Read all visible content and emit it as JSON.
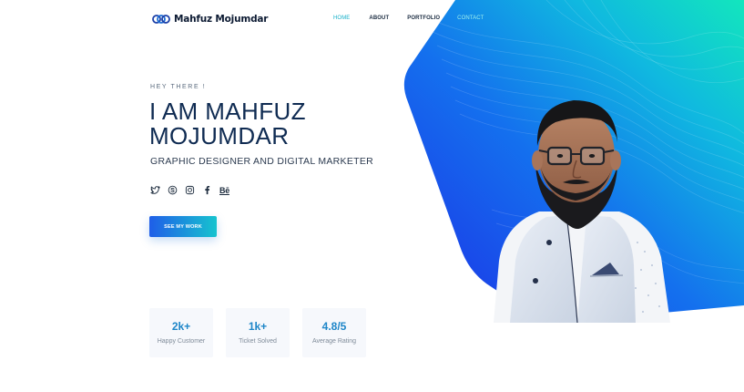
{
  "brand": {
    "name": "Mahfuz Mojumdar"
  },
  "nav": [
    {
      "label": "HOME",
      "state": "active"
    },
    {
      "label": "ABOUT",
      "state": ""
    },
    {
      "label": "PORTFOLIO",
      "state": ""
    },
    {
      "label": "CONTACT",
      "state": "on-color"
    }
  ],
  "hero": {
    "eyebrow": "HEY THERE !",
    "headline": "I AM MAHFUZ MOJUMDAR",
    "subtitle": "GRAPHIC DESIGNER AND DIGITAL MARKETER",
    "cta": "SEE MY WORK"
  },
  "socials": [
    {
      "icon": "twitter-icon"
    },
    {
      "icon": "skype-icon"
    },
    {
      "icon": "instagram-icon"
    },
    {
      "icon": "facebook-icon"
    },
    {
      "icon": "behance-icon",
      "text": "Bē"
    }
  ],
  "stats": [
    {
      "value": "2k+",
      "label": "Happy Customer"
    },
    {
      "value": "1k+",
      "label": "Ticket Solved"
    },
    {
      "value": "4.8/5",
      "label": "Average Rating"
    }
  ],
  "colors": {
    "accent": "#15b0c9",
    "headline": "#0f2b52",
    "stat_value": "#1e86c8",
    "gradient_start": "#1a36e8",
    "gradient_end": "#14e0c0",
    "stat_card": "#f6f8fc"
  }
}
